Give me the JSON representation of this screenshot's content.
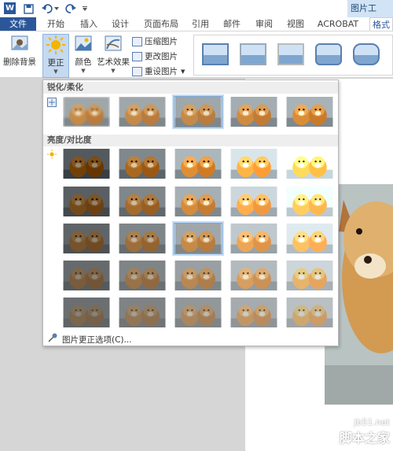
{
  "titlebar": {
    "app_logo": "W",
    "contextual_tab_group": "图片工",
    "quick_access_icons": [
      "save-icon",
      "undo-icon",
      "redo-icon",
      "customize-icon"
    ]
  },
  "tabs": [
    {
      "label": "文件",
      "kind": "file"
    },
    {
      "label": "开始"
    },
    {
      "label": "插入"
    },
    {
      "label": "设计"
    },
    {
      "label": "页面布局"
    },
    {
      "label": "引用"
    },
    {
      "label": "邮件"
    },
    {
      "label": "审阅"
    },
    {
      "label": "视图"
    },
    {
      "label": "ACROBAT"
    },
    {
      "label": "格式",
      "kind": "active"
    }
  ],
  "ribbon": {
    "remove_bg": "删除背景",
    "corrections": "更正",
    "color": "颜色",
    "artistic": "艺术效果",
    "compress": "压缩图片",
    "change": "更改图片",
    "reset": "重设图片"
  },
  "dropdown": {
    "sharpen_title": "锐化/柔化",
    "brightness_title": "亮度/对比度",
    "options_link": "图片更正选项(C)...",
    "sharpen_selected": 2,
    "brightness_selected": [
      2,
      2
    ]
  },
  "watermark": {
    "url": "jb51.net",
    "name": "脚本之家"
  },
  "colors": {
    "accent": "#2b579a",
    "highlight": "#c5d9f0"
  }
}
